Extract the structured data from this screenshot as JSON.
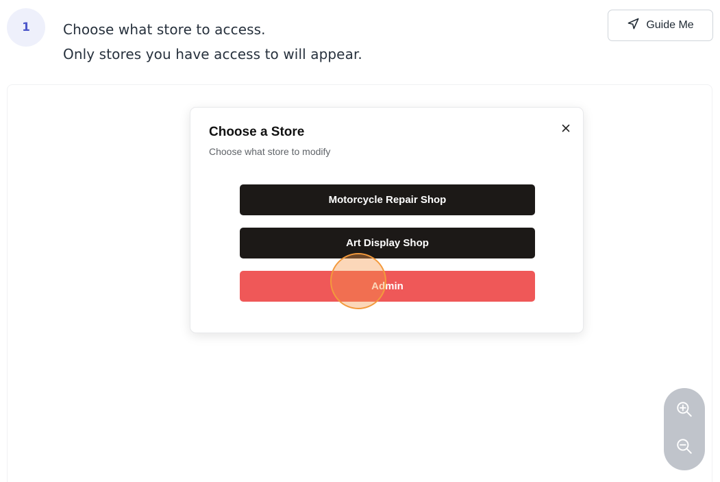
{
  "step": {
    "number": "1",
    "line1": "Choose what store to access.",
    "line2": "Only stores you have access to will appear."
  },
  "guide_button": {
    "label": "Guide Me",
    "icon": "navigation-arrow-icon"
  },
  "modal": {
    "title": "Choose a Store",
    "subtitle": "Choose what store to modify",
    "close_icon": "close-icon",
    "stores": [
      {
        "label": "Motorcycle Repair Shop",
        "style": "dark"
      },
      {
        "label": "Art Display Shop",
        "style": "dark"
      },
      {
        "label": "Admin",
        "style": "danger"
      }
    ]
  },
  "zoom": {
    "in_icon": "zoom-in-icon",
    "out_icon": "zoom-out-icon"
  },
  "colors": {
    "accent_badge_bg": "#eef0fb",
    "accent_badge_text": "#4b55c9",
    "dark_button": "#1c1917",
    "danger_button": "#ef5858",
    "click_marker": "#f39a3c",
    "zoom_panel": "#c0c4cb"
  }
}
